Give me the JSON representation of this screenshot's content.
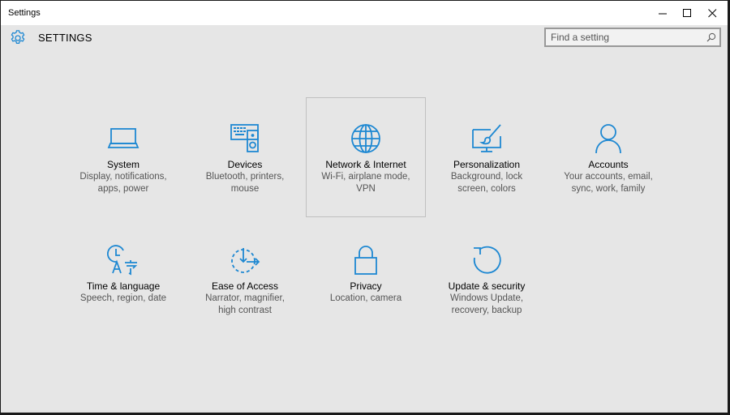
{
  "window": {
    "title": "Settings",
    "controls": [
      "minimize-icon",
      "maximize-icon",
      "close-icon"
    ]
  },
  "header": {
    "icon": "gear-icon",
    "title": "SETTINGS"
  },
  "search": {
    "placeholder": "Find a setting",
    "value": "",
    "icon": "search-icon"
  },
  "accent_color": "#1e88d2",
  "categories": [
    {
      "title": "System",
      "description": "Display, notifications, apps, power",
      "icon": "laptop-icon"
    },
    {
      "title": "Devices",
      "description": "Bluetooth, printers, mouse",
      "icon": "devices-icon"
    },
    {
      "title": "Network & Internet",
      "description": "Wi-Fi, airplane mode, VPN",
      "icon": "globe-icon",
      "selected": true
    },
    {
      "title": "Personalization",
      "description": "Background, lock screen, colors",
      "icon": "paintbrush-icon"
    },
    {
      "title": "Accounts",
      "description": "Your accounts, email, sync, work, family",
      "icon": "person-icon"
    },
    {
      "title": "Time & language",
      "description": "Speech, region, date",
      "icon": "time-language-icon"
    },
    {
      "title": "Ease of Access",
      "description": "Narrator, magnifier, high contrast",
      "icon": "ease-of-access-icon"
    },
    {
      "title": "Privacy",
      "description": "Location, camera",
      "icon": "lock-icon"
    },
    {
      "title": "Update & security",
      "description": "Windows Update, recovery, backup",
      "icon": "refresh-icon"
    }
  ]
}
